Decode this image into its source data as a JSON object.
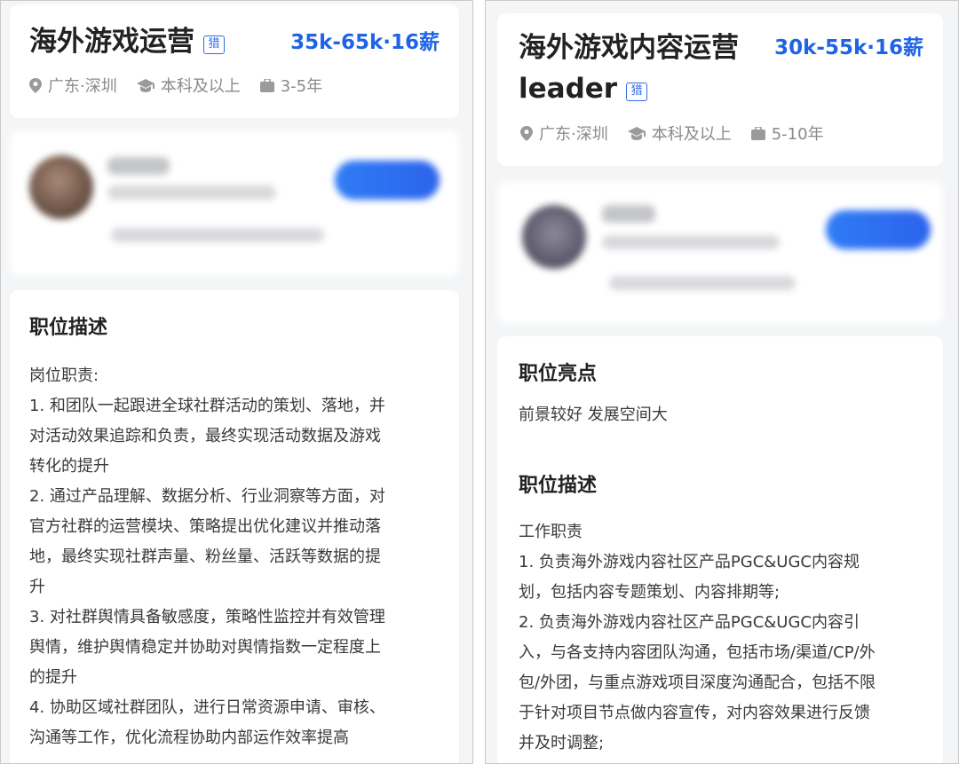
{
  "left": {
    "job": {
      "title": "海外游戏运营",
      "tag": "猎",
      "salary": "35k-65k·16薪",
      "location": "广东·深圳",
      "education": "本科及以上",
      "experience": "3-5年"
    },
    "description": {
      "heading": "职位描述",
      "lines": [
        "岗位职责:",
        "1. 和团队一起跟进全球社群活动的策划、落地，并",
        "对活动效果追踪和负责，最终实现活动数据及游戏",
        "转化的提升",
        "2. 通过产品理解、数据分析、行业洞察等方面，对",
        "官方社群的运营模块、策略提出优化建议并推动落",
        "地，最终实现社群声量、粉丝量、活跃等数据的提",
        "升",
        "3. 对社群舆情具备敏感度，策略性监控并有效管理",
        "舆情，维护舆情稳定并协助对舆情指数一定程度上",
        "的提升",
        "4. 协助区域社群团队，进行日常资源申请、审核、",
        "沟通等工作，优化流程协助内部运作效率提高"
      ]
    }
  },
  "right": {
    "job": {
      "title_line1": "海外游戏内容运营",
      "title_line2": "leader",
      "tag": "猎",
      "salary": "30k-55k·16薪",
      "location": "广东·深圳",
      "education": "本科及以上",
      "experience": "5-10年"
    },
    "highlights": {
      "heading": "职位亮点",
      "text": "前景较好 发展空间大"
    },
    "description": {
      "heading": "职位描述",
      "lines": [
        "工作职责",
        "1. 负责海外游戏内容社区产品PGC&UGC内容规",
        "划，包括内容专题策划、内容排期等;",
        "2. 负责海外游戏内容社区产品PGC&UGC内容引",
        "入，与各支持内容团队沟通，包括市场/渠道/CP/外",
        "包/外团，与重点游戏项目深度沟通配合，包括不限",
        "于针对项目节点做内容宣传，对内容效果进行反馈",
        "并及时调整;"
      ]
    }
  },
  "icons": {
    "location": "location-pin-icon",
    "education": "graduation-cap-icon",
    "experience": "briefcase-icon"
  },
  "colors": {
    "salary": "#1f63e6",
    "tag": "#2f6be8",
    "background": "#f4f5f7",
    "card": "#ffffff",
    "meta_text": "#8a8a8a"
  }
}
